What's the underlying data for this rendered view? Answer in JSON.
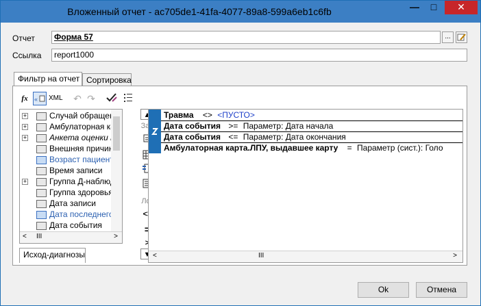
{
  "window": {
    "title": "Вложенный отчет - ac705de1-41fa-4077-89a8-599a6eb1c6fb",
    "min_glyph": "—",
    "max_glyph": "□",
    "close_glyph": "✕"
  },
  "form": {
    "report_label": "Отчет",
    "report_value": "Форма 57",
    "report_browse": "...",
    "link_label": "Ссылка",
    "link_value": "report1000"
  },
  "tabs": [
    {
      "label": "Фильтр на отчет",
      "active": true
    },
    {
      "label": "Сортировка",
      "active": false
    }
  ],
  "toolbar": {
    "fx": "fx",
    "xml": "XML",
    "undo": "↶",
    "redo": "↷"
  },
  "tree": {
    "items": [
      {
        "label": "Случай обращени",
        "expander": "+",
        "style": "normal"
      },
      {
        "label": "Амбулаторная ка",
        "expander": "+",
        "style": "normal"
      },
      {
        "label": "Анкета оценки к",
        "expander": "+",
        "style": "italic"
      },
      {
        "label": "Внешняя причин",
        "expander": "",
        "style": "normal"
      },
      {
        "label": "Возраст пациент",
        "expander": "",
        "style": "blue"
      },
      {
        "label": "Время записи",
        "expander": "",
        "style": "normal"
      },
      {
        "label": "Группа Д-наблюд",
        "expander": "+",
        "style": "normal"
      },
      {
        "label": "Группа здоровья",
        "expander": "",
        "style": "normal"
      },
      {
        "label": "Дата записи",
        "expander": "",
        "style": "normal"
      },
      {
        "label": "Дата последнего",
        "expander": "",
        "style": "blue"
      },
      {
        "label": "Дата события",
        "expander": "",
        "style": "normal"
      }
    ],
    "bottom_tab": "Исход-диагнозы",
    "scroll_thumb": "III"
  },
  "middle": {
    "up": "▲",
    "zap": "Зап",
    "log": "Лог",
    "ne": "<>",
    "eq": "=",
    "gt": ">",
    "down": "▼"
  },
  "conditions": [
    {
      "field": "Травма",
      "op": "<>",
      "value": "<ПУСТО>"
    },
    {
      "field": "Дата события",
      "op": ">=",
      "value": "Параметр: Дата начала"
    },
    {
      "field": "Дата события",
      "op": "<=",
      "value": "Параметр: Дата окончания"
    },
    {
      "field": "Амбулаторная карта.ЛПУ, выдавшее карту",
      "op": "=",
      "value": "Параметр (сист.): Голо"
    }
  ],
  "grid": {
    "scroll_thumb": "III",
    "left_arrow": "<",
    "right_arrow": ">"
  },
  "buttons": {
    "ok": "Ok",
    "cancel": "Отмена"
  }
}
